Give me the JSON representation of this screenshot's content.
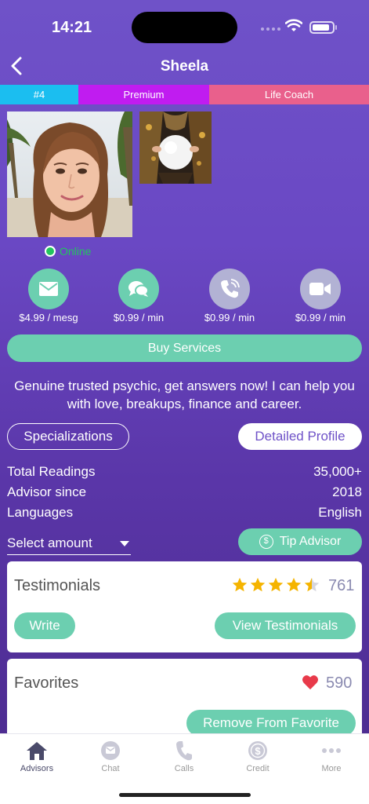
{
  "status": {
    "time": "14:21"
  },
  "nav": {
    "title": "Sheela"
  },
  "tags": {
    "rank": "#4",
    "tier": "Premium",
    "category": "Life Coach"
  },
  "presence": {
    "status": "Online"
  },
  "services": [
    {
      "icon": "mail-icon",
      "price": "$4.99 / mesg",
      "available": true
    },
    {
      "icon": "chat-icon",
      "price": "$0.99 / min",
      "available": true
    },
    {
      "icon": "phone-icon",
      "price": "$0.99 / min",
      "available": false
    },
    {
      "icon": "video-icon",
      "price": "$0.99 / min",
      "available": false
    }
  ],
  "buy_label": "Buy Services",
  "bio": "Genuine trusted psychic, get answers now! I can help you with love, breakups, finance and career.",
  "buttons": {
    "specializations": "Specializations",
    "detailed_profile": "Detailed Profile"
  },
  "info": [
    {
      "label": "Total Readings",
      "value": "35,000+"
    },
    {
      "label": "Advisor since",
      "value": "2018"
    },
    {
      "label": "Languages",
      "value": "English"
    }
  ],
  "tip": {
    "select_placeholder": "Select amount",
    "tip_label": "Tip Advisor"
  },
  "testimonials": {
    "title": "Testimonials",
    "rating": 4.5,
    "count": "761",
    "write_label": "Write",
    "view_label": "View Testimonials"
  },
  "favorites": {
    "title": "Favorites",
    "count": "590",
    "remove_label": "Remove From Favorite"
  },
  "tab_bar": [
    {
      "label": "Advisors",
      "icon": "home-icon",
      "active": true
    },
    {
      "label": "Chat",
      "icon": "chat-icon",
      "active": false
    },
    {
      "label": "Calls",
      "icon": "phone-icon",
      "active": false
    },
    {
      "label": "Credit",
      "icon": "dollar-icon",
      "active": false
    },
    {
      "label": "More",
      "icon": "more-icon",
      "active": false
    }
  ],
  "colors": {
    "accent": "#6ccfb0",
    "tag_rank": "#1bbef0",
    "tag_premium": "#c01cf0",
    "tag_category": "#e9608c",
    "online": "#22c55e",
    "heart": "#e83a4a",
    "star": "#f5b400"
  }
}
